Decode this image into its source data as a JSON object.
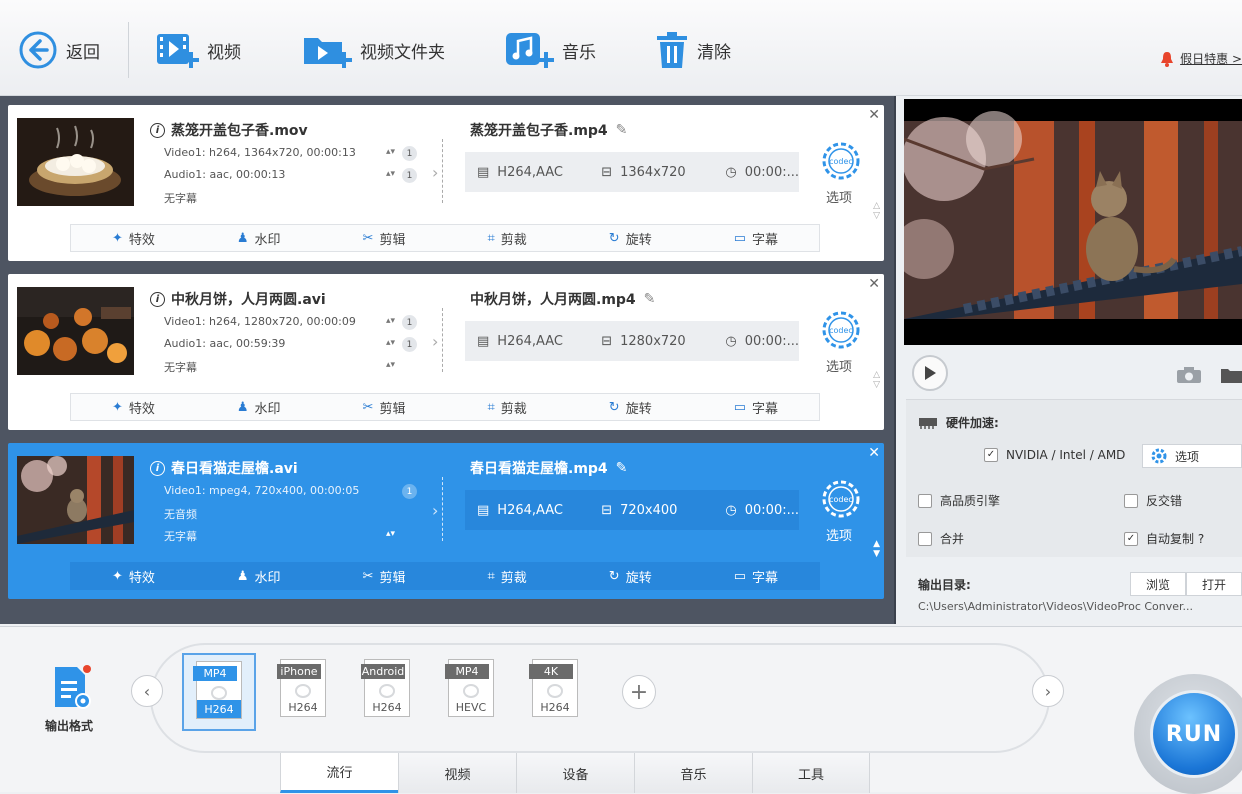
{
  "toolbar": {
    "back": "返回",
    "video": "视频",
    "video_folder": "视频文件夹",
    "music": "音乐",
    "clear": "清除",
    "promo": "假日特惠 >"
  },
  "tools": {
    "effect": "特效",
    "watermark": "水印",
    "cut": "剪辑",
    "crop": "剪裁",
    "rotate": "旋转",
    "subtitle": "字幕"
  },
  "option_label": "选项",
  "items": [
    {
      "src_name": "蒸笼开盖包子香.mov",
      "video_line": "Video1: h264, 1364x720, 00:00:13",
      "audio_line": "Audio1: aac, 00:00:13",
      "sub_line": "无字幕",
      "video_idx": "1",
      "audio_idx": "1",
      "dst_name": "蒸笼开盖包子香.mp4",
      "codec": "H264,AAC",
      "resolution": "1364x720",
      "duration": "00:00:..."
    },
    {
      "src_name": "中秋月饼，人月两圆.avi",
      "video_line": "Video1: h264, 1280x720, 00:00:09",
      "audio_line": "Audio1: aac, 00:59:39",
      "sub_line": "无字幕",
      "video_idx": "1",
      "audio_idx": "1",
      "dst_name": "中秋月饼，人月两圆.mp4",
      "codec": "H264,AAC",
      "resolution": "1280x720",
      "duration": "00:00:..."
    },
    {
      "src_name": "春日看猫走屋檐.avi",
      "video_line": "Video1: mpeg4, 720x400, 00:00:05",
      "audio_line": "无音频",
      "sub_line": "无字幕",
      "video_idx": "1",
      "dst_name": "春日看猫走屋檐.mp4",
      "codec": "H264,AAC",
      "resolution": "720x400",
      "duration": "00:00:..."
    }
  ],
  "settings": {
    "hw_accel": "硬件加速:",
    "nvidia": "NVIDIA / Intel / AMD",
    "options": "选项",
    "hq_engine": "高品质引擎",
    "deinterlace": "反交错",
    "merge": "合并",
    "auto_copy": "自动复制 ?",
    "output_dir_label": "输出目录:",
    "browse": "浏览",
    "open": "打开",
    "output_path": "C:\\Users\\Administrator\\Videos\\VideoProc Conver..."
  },
  "formats": {
    "output_format": "输出格式",
    "list": [
      {
        "top": "MP4",
        "bottom": "H264"
      },
      {
        "top": "iPhone",
        "bottom": "H264"
      },
      {
        "top": "Android",
        "bottom": "H264"
      },
      {
        "top": "MP4",
        "bottom": "HEVC"
      },
      {
        "top": "4K",
        "bottom": "H264"
      }
    ]
  },
  "tabs": [
    "流行",
    "视频",
    "设备",
    "音乐",
    "工具"
  ],
  "run": "RUN",
  "colors": {
    "accent": "#2f93e8",
    "selected_row": "#2f93e8",
    "list_bg": "#4e5562"
  }
}
